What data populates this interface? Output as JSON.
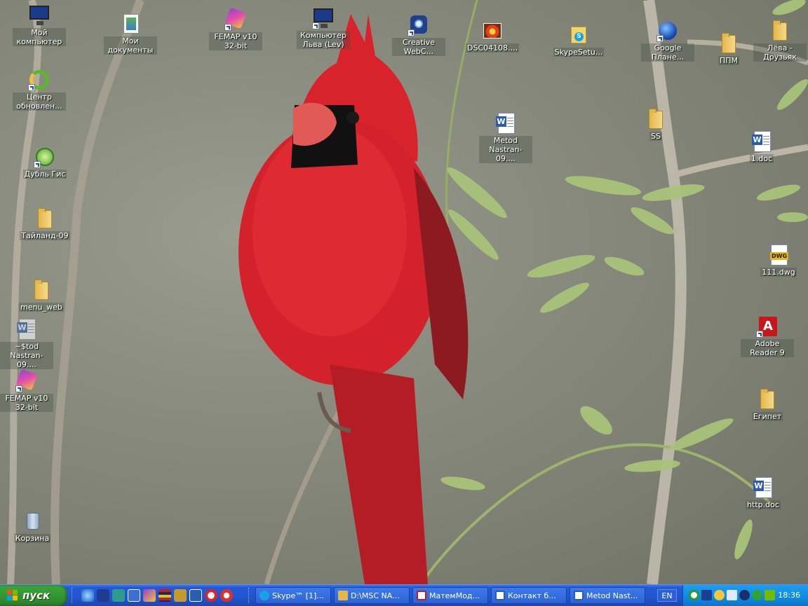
{
  "desktop": {
    "icons": [
      {
        "label": "Мой компьютер",
        "icon": "my-computer-icon"
      },
      {
        "label": "Мои документы",
        "icon": "my-documents-icon"
      },
      {
        "label": "FEMAP v10 32-bit",
        "icon": "femap-icon"
      },
      {
        "label": "Компьютер Льва (Lev)",
        "icon": "network-computer-icon"
      },
      {
        "label": "Creative WebC...",
        "icon": "webcam-icon"
      },
      {
        "label": "DSC04108....",
        "icon": "photo-icon"
      },
      {
        "label": "SkypeSetu...",
        "icon": "skype-setup-icon"
      },
      {
        "label": "Google Плане...",
        "icon": "google-earth-icon"
      },
      {
        "label": "ППМ",
        "icon": "folder-icon"
      },
      {
        "label": "Лёва - Друзьяк",
        "icon": "folder-icon"
      },
      {
        "label": "Центр обновлен...",
        "icon": "update-center-icon"
      },
      {
        "label": "Metod Nastran-09....",
        "icon": "word-doc-icon"
      },
      {
        "label": "SS",
        "icon": "folder-icon"
      },
      {
        "label": "1.doc",
        "icon": "word-doc-icon"
      },
      {
        "label": "Дубль Гис",
        "icon": "dublgis-icon"
      },
      {
        "label": "Тайланд-09",
        "icon": "folder-icon"
      },
      {
        "label": "111.dwg",
        "icon": "dwg-icon"
      },
      {
        "label": "menu_web",
        "icon": "folder-icon"
      },
      {
        "label": "~$tod Nastran-09....",
        "icon": "word-doc-icon"
      },
      {
        "label": "Adobe Reader 9",
        "icon": "adobe-reader-icon"
      },
      {
        "label": "FEMAP v10 32-bit",
        "icon": "femap-icon"
      },
      {
        "label": "Египет",
        "icon": "folder-icon"
      },
      {
        "label": "http.doc",
        "icon": "word-doc-icon"
      },
      {
        "label": "Корзина",
        "icon": "recycle-bin-icon"
      }
    ]
  },
  "taskbar": {
    "start_label": "пуск",
    "quick_launch": [
      "internet-explorer-icon",
      "app-icon",
      "network-icon",
      "calc-icon",
      "femap-icon",
      "winrar-icon",
      "archive-icon",
      "word-icon",
      "opera-icon",
      "media-icon"
    ],
    "tasks": [
      {
        "label": "Skype™ [1]...",
        "icon": "skype-icon",
        "color": "#14a4e4"
      },
      {
        "label": "D:\\MSC NA...",
        "icon": "folder-icon",
        "color": "#e3b84a"
      },
      {
        "label": "МатемМод...",
        "icon": "pdf-icon",
        "color": "#c8161d"
      },
      {
        "label": "Контакт б...",
        "icon": "word-icon",
        "color": "#2a5db0"
      },
      {
        "label": "Metod Nast...",
        "icon": "word-icon",
        "color": "#2a5db0"
      }
    ],
    "language": "EN",
    "tray_icons": [
      "green-circle-icon",
      "network-tray-icon",
      "security-icon",
      "volume-icon",
      "webcam-tray-icon",
      "update-tray-icon",
      "nvidia-icon"
    ],
    "clock": "18:36"
  },
  "colors": {
    "taskbar_blue": "#2154cf",
    "start_green": "#37a437",
    "tray_blue": "#0f89e0"
  }
}
